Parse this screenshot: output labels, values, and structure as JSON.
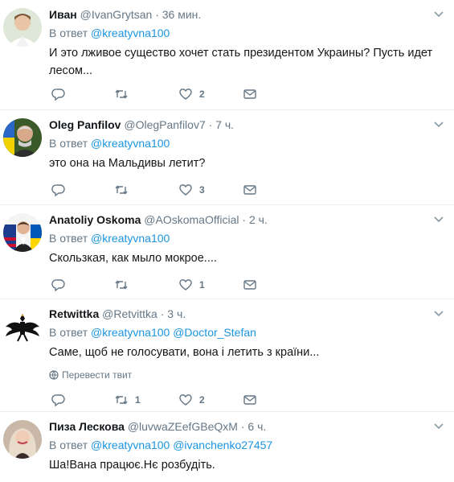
{
  "reply_prefix": "В ответ",
  "translate_label": "Перевести твит",
  "colors": {
    "link": "#1b95e0",
    "muted": "#657786",
    "text": "#14171a",
    "divider": "#e6ecf0"
  },
  "icons": {
    "reply": "reply-icon",
    "retweet": "retweet-icon",
    "like": "heart-icon",
    "dm": "envelope-icon",
    "menu": "chevron-down-icon",
    "translate": "globe-icon"
  },
  "tweets": [
    {
      "name": "Иван",
      "handle": "@IvanGrytsan",
      "time": "36 мин.",
      "mentions": [
        "@kreatyvna100"
      ],
      "text": "И это лживое существо хочет стать президентом Украины? Пусть идет лесом...",
      "retweets": "",
      "likes": "2"
    },
    {
      "name": "Oleg Panfilov",
      "handle": "@OlegPanfilov7",
      "time": "7 ч.",
      "mentions": [
        "@kreatyvna100"
      ],
      "text": "это она на Мальдивы летит?",
      "retweets": "",
      "likes": "3"
    },
    {
      "name": "Anatoliy Oskoma",
      "handle": "@AOskomaOfficial",
      "time": "2 ч.",
      "mentions": [
        "@kreatyvna100"
      ],
      "text": "Скользкая, как мыло мокрое....",
      "retweets": "",
      "likes": "1"
    },
    {
      "name": "Retwittka",
      "handle": "@Retvittka",
      "time": "3 ч.",
      "mentions": [
        "@kreatyvna100",
        "@Doctor_Stefan"
      ],
      "text": "Саме, щоб не голосувати, вона і летить з країни...",
      "retweets": "1",
      "likes": "2"
    },
    {
      "name": "Пиза Лескова",
      "handle": "@luvwaZEefGBeQxM",
      "time": "6 ч.",
      "mentions": [
        "@kreatyvna100",
        "@ivanchenko27457"
      ],
      "text": "Ша!Вана працює.Нє розбудіть.",
      "retweets": "",
      "likes": ""
    }
  ]
}
